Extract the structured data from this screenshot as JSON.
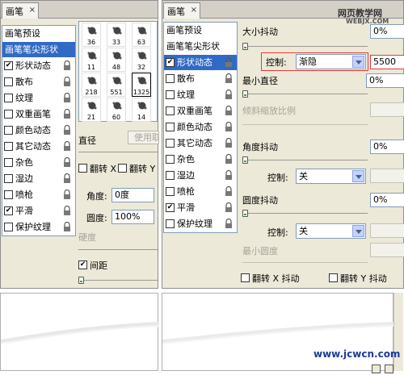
{
  "tab_title": "画笔",
  "close_icon": "×",
  "left": {
    "list": [
      {
        "label": "画笔预设",
        "header": true
      },
      {
        "label": "画笔笔尖形状",
        "selected": true
      },
      {
        "label": "形状动态",
        "checked": true
      },
      {
        "label": "散布",
        "checked": false
      },
      {
        "label": "纹理",
        "checked": false
      },
      {
        "label": "双重画笔",
        "checked": false
      },
      {
        "label": "颜色动态",
        "checked": false
      },
      {
        "label": "其它动态",
        "checked": false
      },
      {
        "label": "杂色",
        "checked": false
      },
      {
        "label": "湿边",
        "checked": false
      },
      {
        "label": "喷枪",
        "checked": false
      },
      {
        "label": "平滑",
        "checked": true
      },
      {
        "label": "保护纹理",
        "checked": false
      }
    ],
    "brushes": [
      {
        "num": "36"
      },
      {
        "num": "33"
      },
      {
        "num": "63"
      },
      {
        "num": "11"
      },
      {
        "num": "48"
      },
      {
        "num": "32"
      },
      {
        "num": "218"
      },
      {
        "num": "551"
      },
      {
        "num": "1325",
        "selected": true
      },
      {
        "num": "21"
      },
      {
        "num": "60"
      },
      {
        "num": "14"
      }
    ],
    "diameter_label": "直径",
    "use_sample_button": "使用取",
    "flip_x": "翻转 X",
    "flip_y": "翻转 Y",
    "angle_label": "角度:",
    "angle_value": "0度",
    "roundness_label": "圆度:",
    "roundness_value": "100%",
    "hardness_label": "硬度",
    "spacing_label": "间距",
    "spacing_checked": true
  },
  "right": {
    "list": [
      {
        "label": "画笔预设",
        "header": true
      },
      {
        "label": "画笔笔尖形状",
        "header": true
      },
      {
        "label": "形状动态",
        "selected": true,
        "checked": true
      },
      {
        "label": "散布",
        "checked": false
      },
      {
        "label": "纹理",
        "checked": false
      },
      {
        "label": "双重画笔",
        "checked": false
      },
      {
        "label": "颜色动态",
        "checked": false
      },
      {
        "label": "其它动态",
        "checked": false
      },
      {
        "label": "杂色",
        "checked": false
      },
      {
        "label": "湿边",
        "checked": false
      },
      {
        "label": "喷枪",
        "checked": false
      },
      {
        "label": "平滑",
        "checked": true
      },
      {
        "label": "保护纹理",
        "checked": false
      }
    ],
    "size_jitter_label": "大小抖动",
    "size_jitter_value": "0%",
    "control_label": "控制:",
    "control1_value": "渐隐",
    "control1_steps": "5500",
    "min_diameter_label": "最小直径",
    "min_diameter_value": "0%",
    "tilt_scale_label": "倾斜缩放比例",
    "angle_jitter_label": "角度抖动",
    "angle_jitter_value": "0%",
    "control2_value": "关",
    "roundness_jitter_label": "圆度抖动",
    "roundness_jitter_value": "0%",
    "control3_value": "关",
    "min_roundness_label": "最小圆度",
    "flip_x_jitter": "翻转 X 抖动",
    "flip_y_jitter": "翻转 Y 抖动"
  },
  "watermark_top_line1": "网页教学网",
  "watermark_top_line2": "WEBJX.COM",
  "watermark_bottom": "www.jcwcn.com",
  "colors": {
    "selection": "#316ac5",
    "panel": "#ece9d8",
    "highlight_box": "#e33b3b"
  }
}
